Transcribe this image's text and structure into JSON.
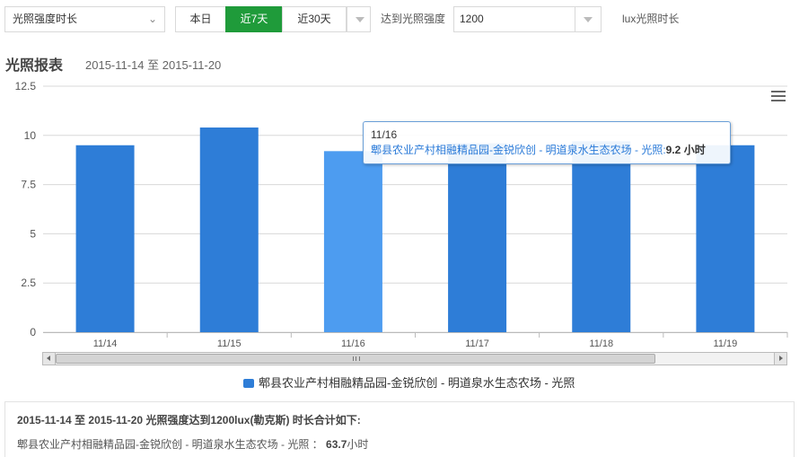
{
  "toolbar": {
    "metric_select": "光照强度时长",
    "range_today": "本日",
    "range_7days": "近7天",
    "range_30days": "近30天",
    "threshold_label": "达到光照强度",
    "threshold_value": "1200",
    "threshold_unit": "lux光照时长"
  },
  "report": {
    "title": "光照报表",
    "range": "2015-11-14 至 2015-11-20"
  },
  "chart_data": {
    "type": "bar",
    "categories": [
      "11/14",
      "11/15",
      "11/16",
      "11/17",
      "11/18",
      "11/19"
    ],
    "y_ticks": [
      "0",
      "2.5",
      "5",
      "7.5",
      "10",
      "12.5"
    ],
    "ylim": [
      0,
      12.5
    ],
    "series": [
      {
        "name": "郫县农业产村相融精品园-金锐欣创 - 明道泉水生态农场 - 光照",
        "values": [
          9.5,
          10.4,
          9.2,
          9.6,
          9.7,
          9.5
        ]
      }
    ],
    "highlight_index": 2,
    "colors": {
      "bar": "#2e7dd7",
      "bar_hover": "#4d9cf0",
      "grid": "#d8d8d8"
    },
    "grid": true,
    "legend": "bottom-center"
  },
  "tooltip": {
    "date": "11/16",
    "series": "郫县农业产村相融精品园-金锐欣创 - 明道泉水生态农场 - 光照:",
    "value": "9.2 小时"
  },
  "summary": {
    "title": "2015-11-14 至 2015-11-20 光照强度达到1200lux(勒克斯) 时长合计如下:",
    "line_label": "郫县农业产村相融精品园-金锐欣创 - 明道泉水生态农场 - 光照 ：",
    "line_value": "63.7",
    "line_unit": "小时"
  }
}
